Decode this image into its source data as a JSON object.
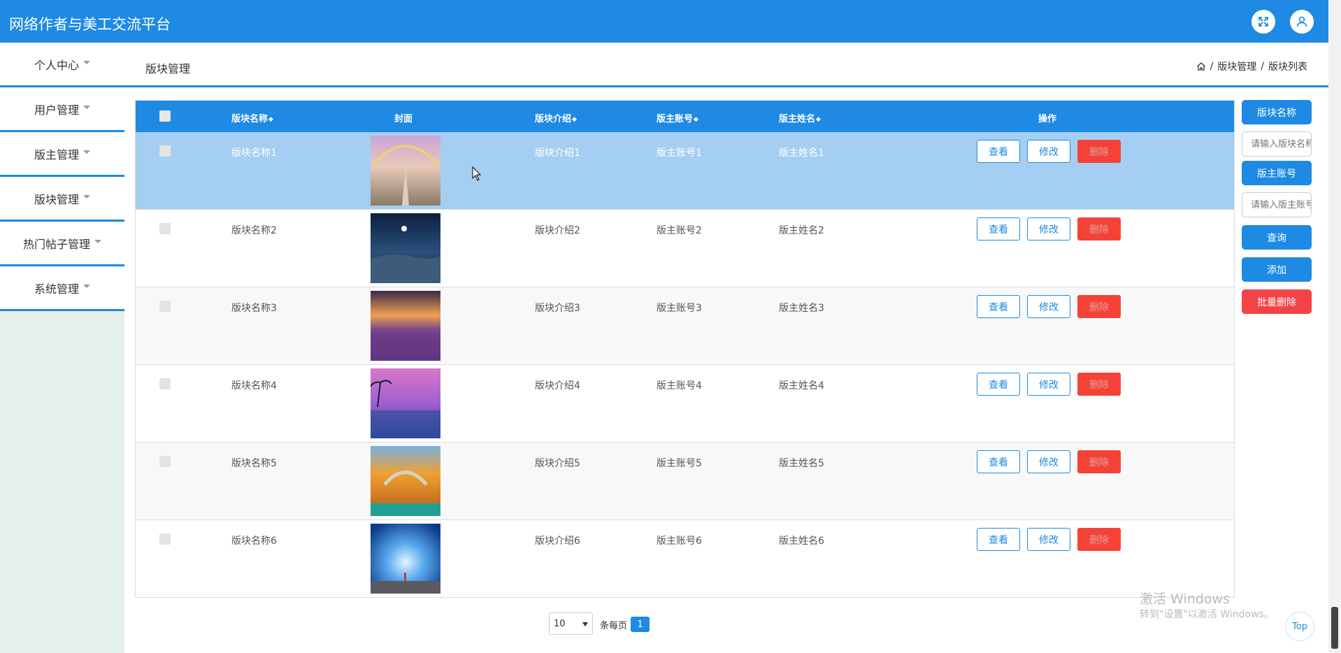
{
  "app": {
    "title": "网络作者与美工交流平台"
  },
  "header": {
    "fullscreen_icon": "fullscreen-icon",
    "user_icon": "user-icon"
  },
  "sidebar": {
    "items": [
      {
        "label": "个人中心"
      },
      {
        "label": "用户管理"
      },
      {
        "label": "版主管理"
      },
      {
        "label": "版块管理"
      },
      {
        "label": "热门帖子管理"
      },
      {
        "label": "系统管理"
      }
    ]
  },
  "breadcrumb": {
    "page_title": "版块管理",
    "items": [
      "版块管理",
      "版块列表"
    ],
    "separator": "/"
  },
  "table": {
    "columns": {
      "name": "版块名称",
      "cover": "封面",
      "intro": "版块介绍",
      "account": "版主账号",
      "owner_name": "版主姓名",
      "actions": "操作"
    },
    "rows": [
      {
        "name": "版块名称1",
        "intro": "版块介绍1",
        "account": "版主账号1",
        "owner_name": "版主姓名1"
      },
      {
        "name": "版块名称2",
        "intro": "版块介绍2",
        "account": "版主账号2",
        "owner_name": "版主姓名2"
      },
      {
        "name": "版块名称3",
        "intro": "版块介绍3",
        "account": "版主账号3",
        "owner_name": "版主姓名3"
      },
      {
        "name": "版块名称4",
        "intro": "版块介绍4",
        "account": "版主账号4",
        "owner_name": "版主姓名4"
      },
      {
        "name": "版块名称5",
        "intro": "版块介绍5",
        "account": "版主账号5",
        "owner_name": "版主姓名5"
      },
      {
        "name": "版块名称6",
        "intro": "版块介绍6",
        "account": "版主账号6",
        "owner_name": "版主姓名6"
      }
    ],
    "actions": {
      "view": "查看",
      "edit": "修改",
      "delete": "删除"
    }
  },
  "search": {
    "name_label": "版块名称",
    "name_placeholder": "请输入版块名称",
    "account_label": "版主账号",
    "account_placeholder": "请输入版主账号",
    "query": "查询",
    "add": "添加",
    "batch_delete": "批量删除"
  },
  "pagination": {
    "page_size": "10",
    "page_size_label": "条每页",
    "current_page": "1"
  },
  "watermark": {
    "title": "激活 Windows",
    "subtitle": "转到\"设置\"以激活 Windows。"
  },
  "top_button": "Top",
  "colors": {
    "primary": "#1e8ae3",
    "danger": "#f44336",
    "hover_row": "#a4cff2",
    "sidebar_bg": "#e6f0eb"
  }
}
